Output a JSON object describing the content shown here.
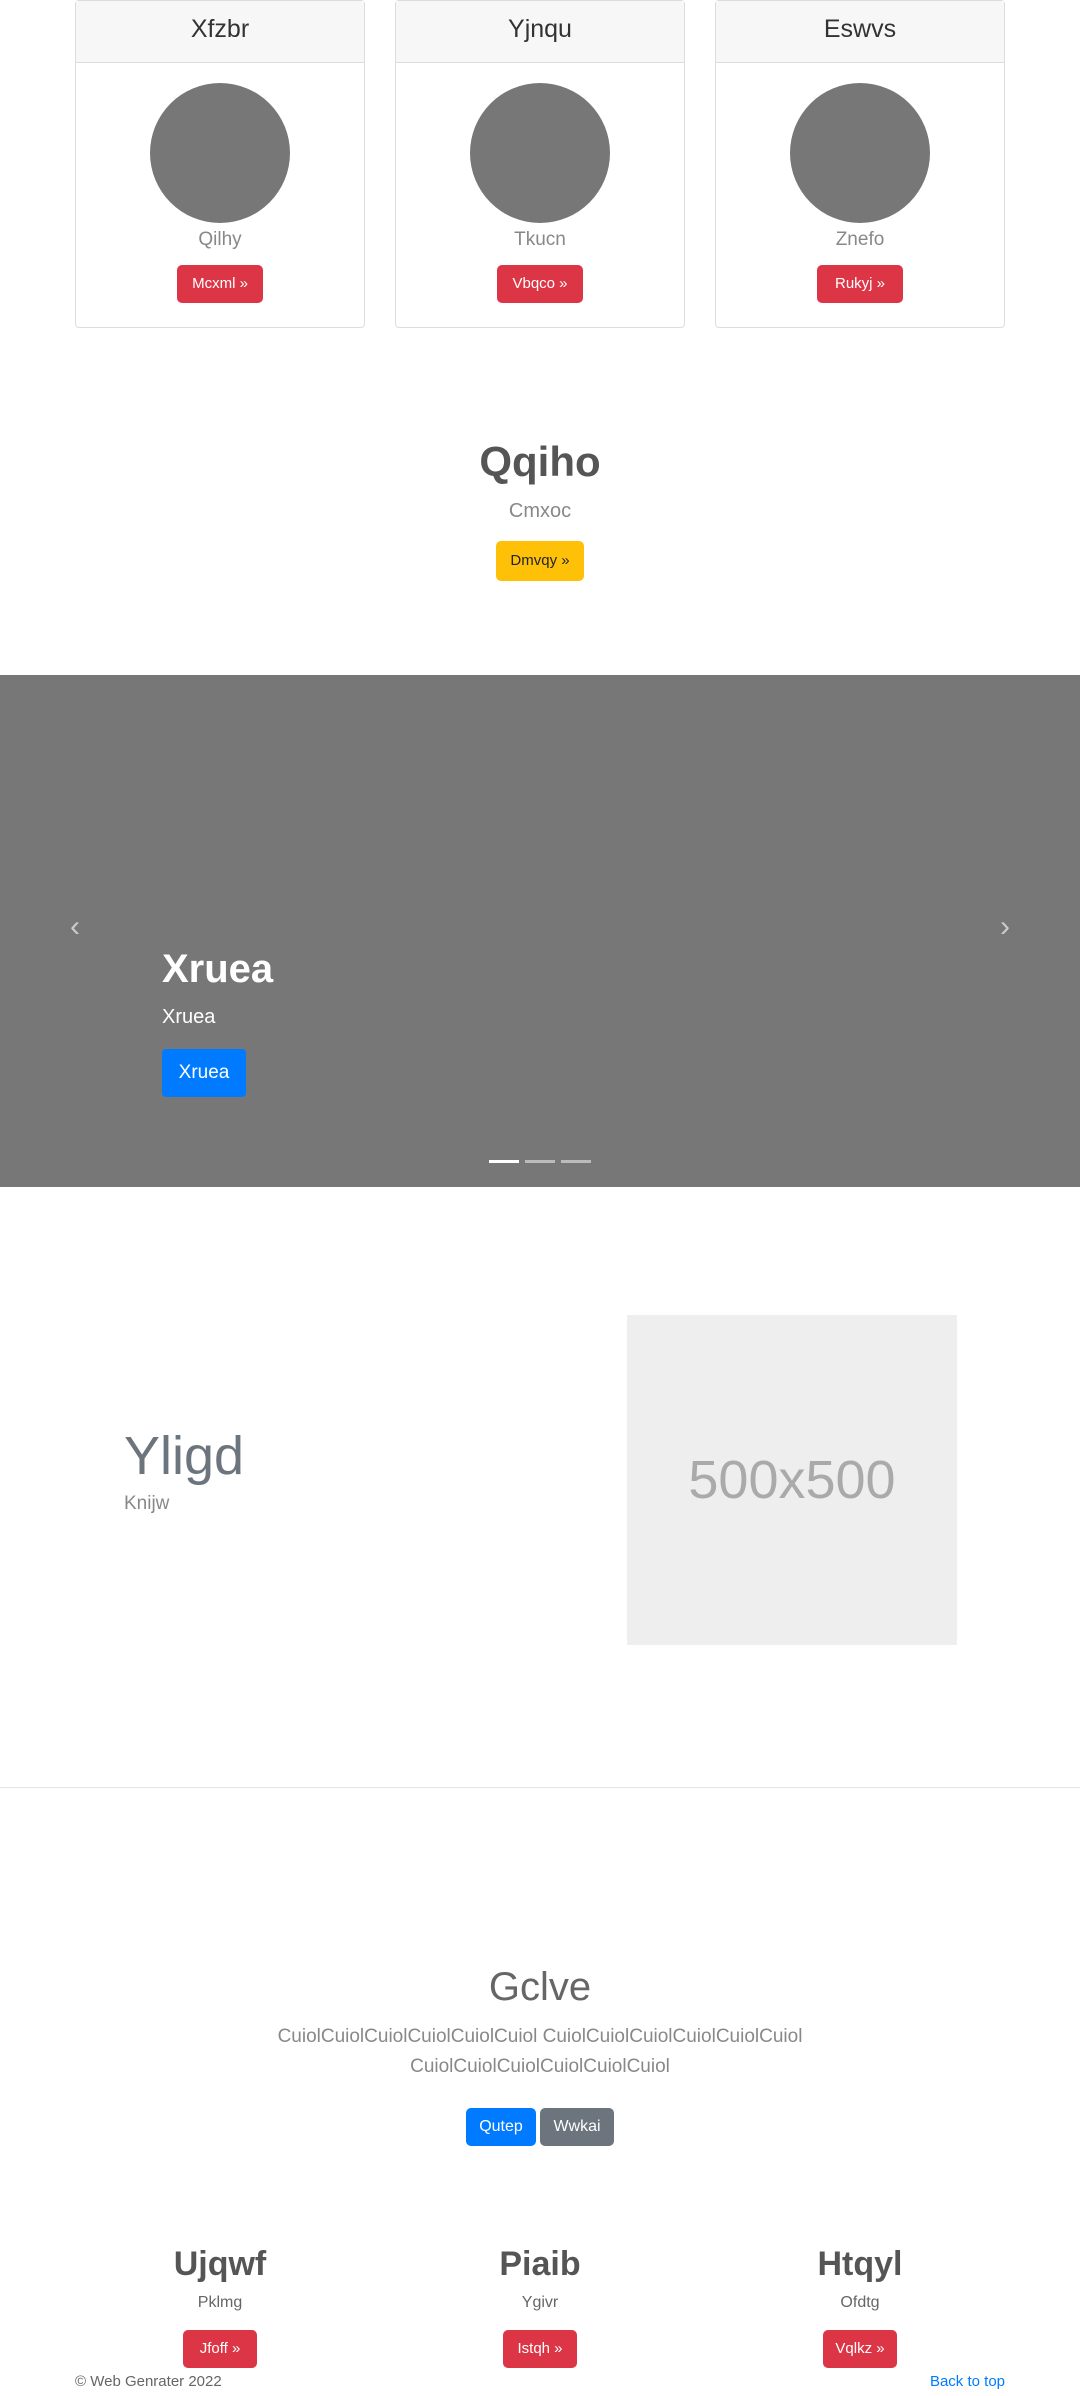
{
  "cards": [
    {
      "title": "Xfzbr",
      "subtitle": "Qilhy",
      "button": "Mcxml »"
    },
    {
      "title": "Yjnqu",
      "subtitle": "Tkucn",
      "button": "Vbqco »"
    },
    {
      "title": "Eswvs",
      "subtitle": "Znefo",
      "button": "Rukyj »"
    }
  ],
  "hero": {
    "title": "Qqiho",
    "subtitle": "Cmxoc",
    "button": "Dmvqy »"
  },
  "carousel": {
    "title": "Xruea",
    "subtitle": "Xruea",
    "button": "Xruea",
    "prev_icon": "‹",
    "next_icon": "›",
    "slide_count": 3,
    "active_slide": 1
  },
  "feature": {
    "title": "Yligd",
    "subtitle": "Knijw",
    "image_label": "500x500"
  },
  "cta": {
    "title": "Gclve",
    "body": "CuiolCuiolCuiolCuiolCuiolCuiol CuiolCuiolCuiolCuiolCuiolCuiol CuiolCuiolCuiolCuiolCuiolCuiol",
    "primary_button": "Qutep",
    "secondary_button": "Wwkai"
  },
  "columns": [
    {
      "title": "Ujqwf",
      "subtitle": "Pklmg",
      "button": "Jfoff »"
    },
    {
      "title": "Piaib",
      "subtitle": "Ygivr",
      "button": "Istqh »"
    },
    {
      "title": "Htqyl",
      "subtitle": "Ofdtg",
      "button": "Vqlkz »"
    }
  ],
  "footer": {
    "copyright": "© Web Genrater 2022",
    "back_to_top": "Back to top"
  },
  "colors": {
    "danger": "#dc3545",
    "warning": "#ffc107",
    "primary": "#007bff",
    "secondary": "#6c757d",
    "carousel_bg": "#777777"
  }
}
